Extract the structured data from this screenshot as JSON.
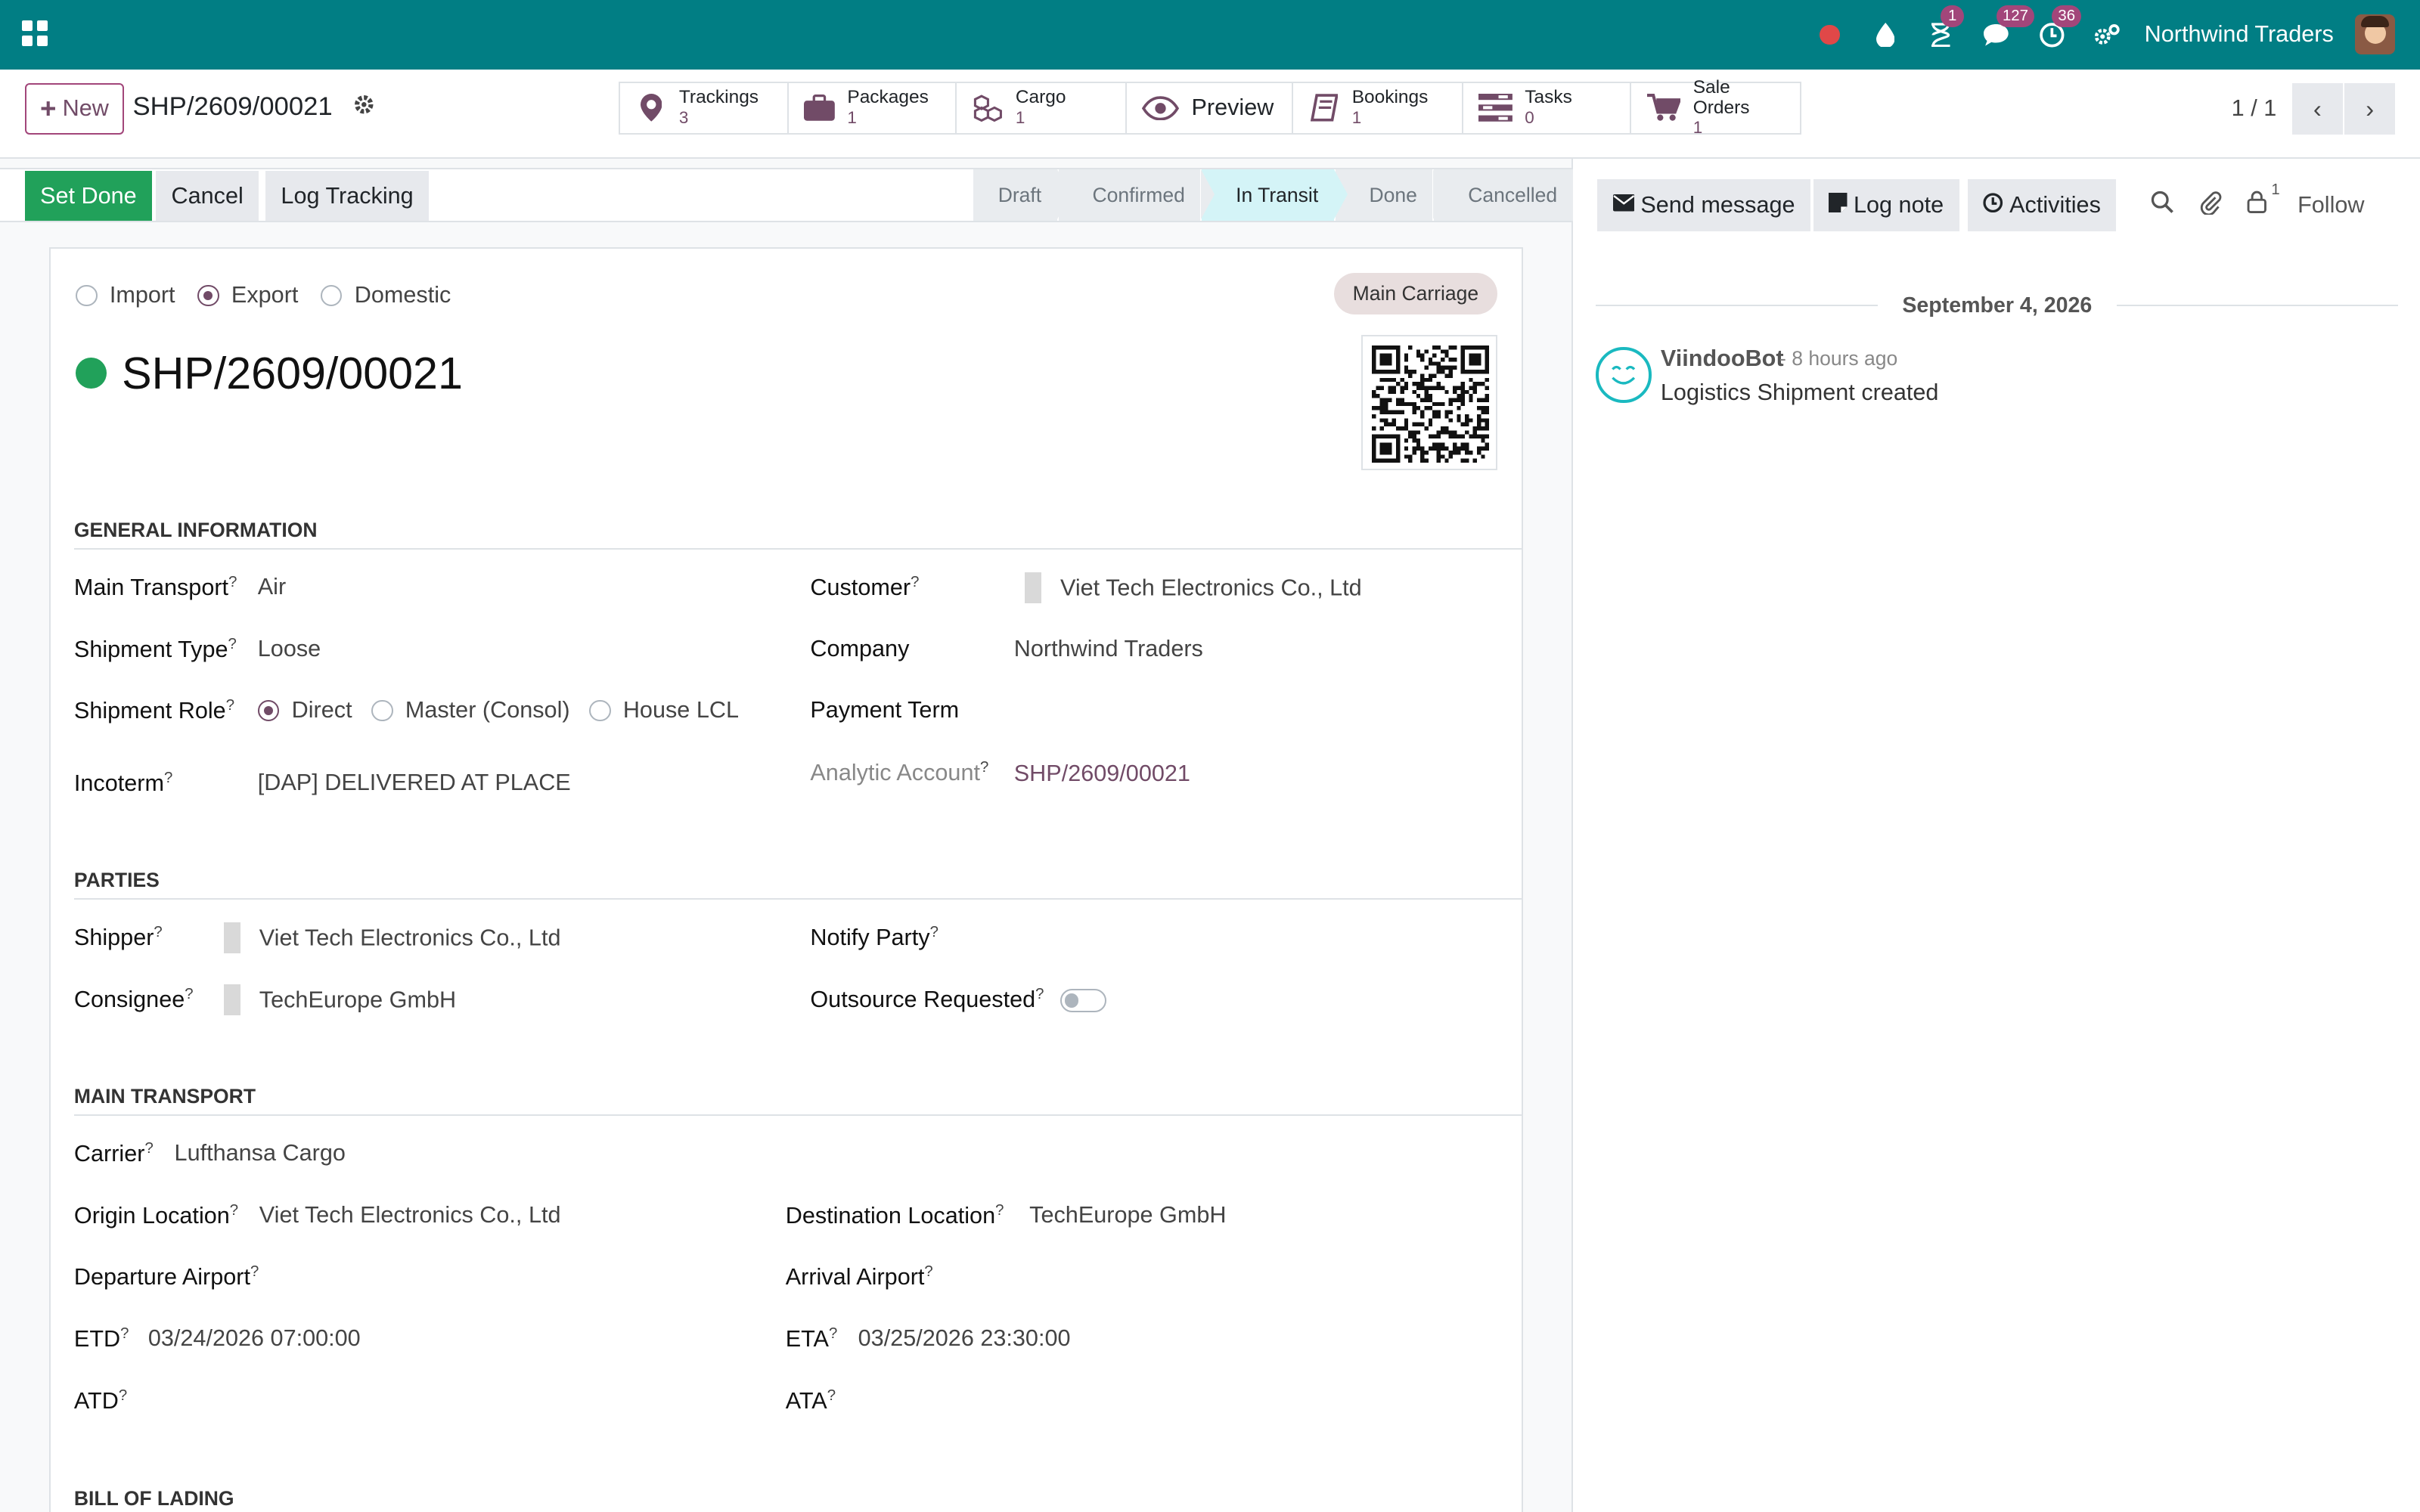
{
  "navbar": {
    "company": "Northwind Traders",
    "badges": {
      "activities": "1",
      "messages": "127",
      "clock": "36"
    }
  },
  "control": {
    "new_label": "New",
    "record_name": "SHP/2609/00021",
    "pager": "1 / 1",
    "smart_buttons": [
      {
        "label": "Trackings",
        "count": "3",
        "icon": "map-pin-icon"
      },
      {
        "label": "Packages",
        "count": "1",
        "icon": "briefcase-icon"
      },
      {
        "label": "Cargo",
        "count": "1",
        "icon": "cubes-icon"
      },
      {
        "label": "Preview",
        "icon": "eye-icon"
      },
      {
        "label": "Bookings",
        "count": "1",
        "icon": "book-icon"
      },
      {
        "label": "Tasks",
        "count": "0",
        "icon": "tasks-icon"
      },
      {
        "label": "Sale Orders",
        "count": "1",
        "icon": "cart-icon"
      }
    ]
  },
  "statusbar": {
    "buttons": [
      "Set Done",
      "Cancel",
      "Log Tracking"
    ],
    "stages": [
      "Draft",
      "Confirmed",
      "In Transit",
      "Done",
      "Cancelled"
    ],
    "active_stage": "In Transit"
  },
  "form": {
    "direction_options": [
      "Import",
      "Export",
      "Domestic"
    ],
    "direction_selected": "Export",
    "tag": "Main Carriage",
    "title": "SHP/2609/00021",
    "sections": {
      "general": "GENERAL INFORMATION",
      "parties": "PARTIES",
      "main_transport": "MAIN TRANSPORT",
      "bill_of_lading": "BILL OF LADING"
    },
    "general": {
      "main_transport_label": "Main Transport",
      "main_transport": "Air",
      "shipment_type_label": "Shipment Type",
      "shipment_type": "Loose",
      "shipment_role_label": "Shipment Role",
      "roles": [
        "Direct",
        "Master (Consol)",
        "House LCL"
      ],
      "role_selected": "Direct",
      "incoterm_label": "Incoterm",
      "incoterm": "[DAP] DELIVERED AT PLACE",
      "customer_label": "Customer",
      "customer": "Viet Tech Electronics Co., Ltd",
      "company_label": "Company",
      "company": "Northwind Traders",
      "payment_term_label": "Payment Term",
      "analytic_label": "Analytic Account",
      "analytic": "SHP/2609/00021"
    },
    "parties": {
      "shipper_label": "Shipper",
      "shipper": "Viet Tech Electronics Co., Ltd",
      "consignee_label": "Consignee",
      "consignee": "TechEurope GmbH",
      "notify_label": "Notify Party",
      "outsource_label": "Outsource Requested"
    },
    "transport": {
      "carrier_label": "Carrier",
      "carrier": "Lufthansa Cargo",
      "origin_label": "Origin Location",
      "origin": "Viet Tech Electronics Co., Ltd",
      "destination_label": "Destination Location",
      "destination": "TechEurope GmbH",
      "departure_label": "Departure Airport",
      "arrival_label": "Arrival Airport",
      "etd_label": "ETD",
      "etd": "03/24/2026 07:00:00",
      "eta_label": "ETA",
      "eta": "03/25/2026 23:30:00",
      "atd_label": "ATD",
      "ata_label": "ATA"
    }
  },
  "chatter": {
    "send_message": "Send message",
    "log_note": "Log note",
    "activities": "Activities",
    "followers_count": "1",
    "follow": "Follow",
    "date": "September 4, 2026",
    "message": {
      "author": "ViindooBot",
      "time": "- 8 hours ago",
      "body": "Logistics Shipment created"
    }
  }
}
